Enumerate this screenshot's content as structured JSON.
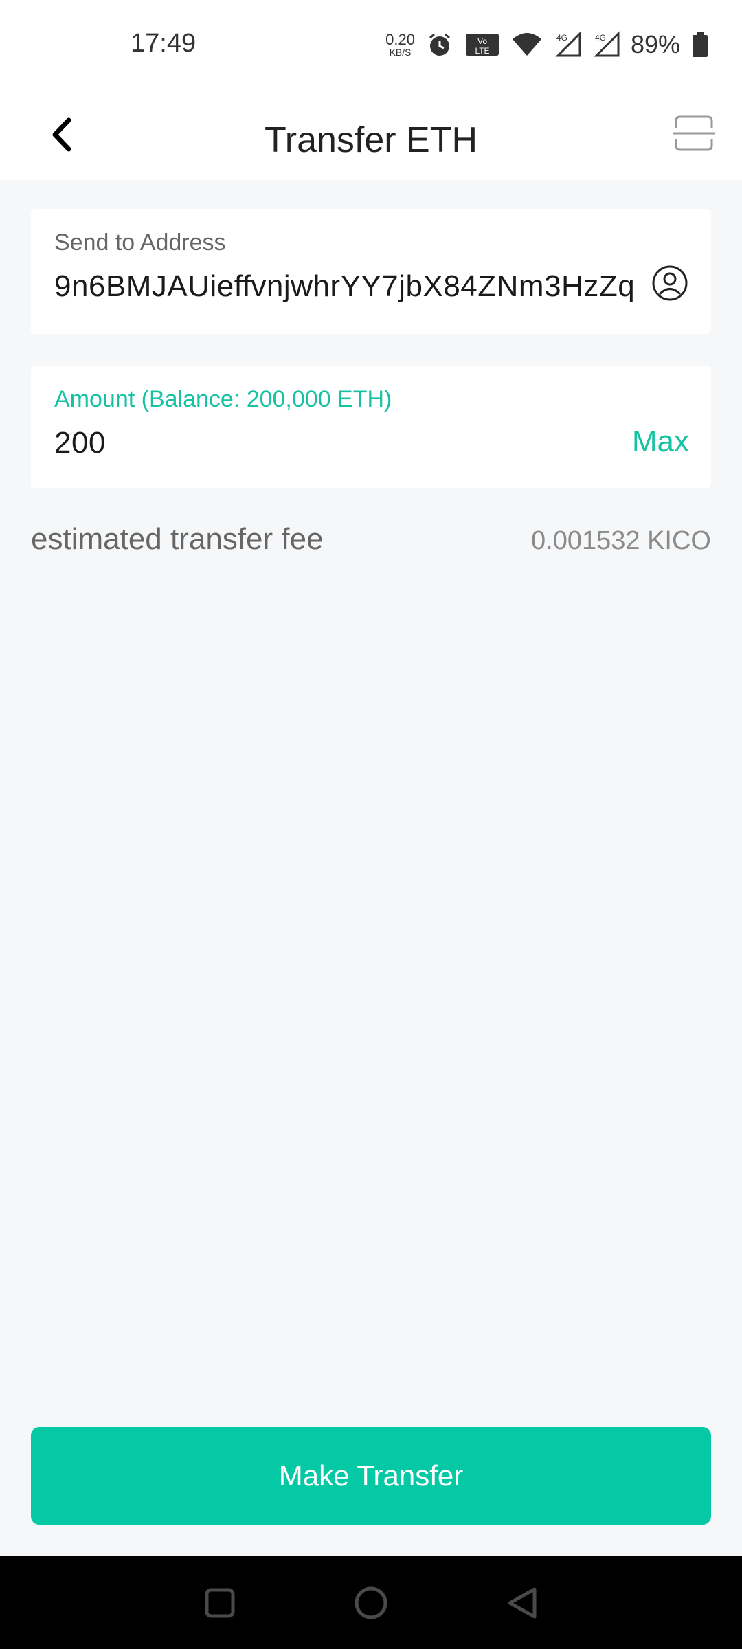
{
  "status_bar": {
    "time": "17:49",
    "net_speed_value": "0.20",
    "net_speed_unit": "KB/S",
    "icons": [
      "alarm-icon",
      "volte-icon",
      "wifi-icon",
      "signal-4g-icon",
      "signal-4g-icon",
      "battery-icon"
    ],
    "battery_percent": "89%"
  },
  "header": {
    "title": "Transfer ETH",
    "back_icon": "chevron-left-icon",
    "scan_icon": "scan-icon"
  },
  "address_field": {
    "label": "Send to Address",
    "value": "9n6BMJAUieffvnjwhrYY7jbX84ZNm3HzZq",
    "contact_icon": "user-circle-icon"
  },
  "amount_field": {
    "label": "Amount (Balance: 200,000 ETH)",
    "value": "200",
    "max_label": "Max"
  },
  "fee": {
    "label": "estimated transfer fee",
    "value": "0.001532 KICO"
  },
  "actions": {
    "submit_label": "Make Transfer"
  },
  "colors": {
    "accent": "#16c2a3",
    "button": "#05c9a4",
    "background": "#f6f7f8"
  },
  "nav_bar": {
    "icons": [
      "recents-icon",
      "home-icon",
      "back-icon"
    ]
  }
}
